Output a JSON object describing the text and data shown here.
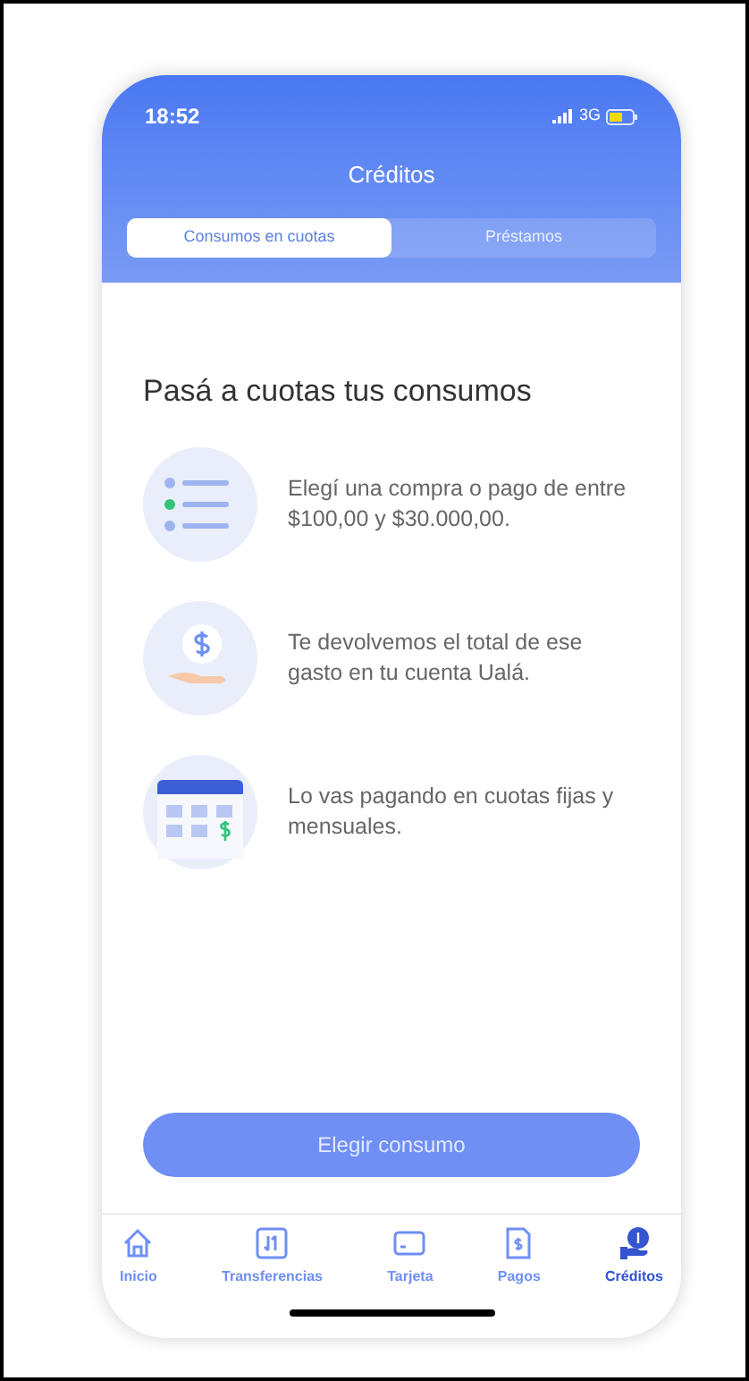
{
  "status_bar": {
    "time": "18:52",
    "network": "3G"
  },
  "header": {
    "title": "Créditos"
  },
  "tabs": [
    {
      "label": "Consumos en cuotas",
      "selected": true
    },
    {
      "label": "Préstamos",
      "selected": false
    }
  ],
  "heading": "Pasá a cuotas tus consumos",
  "steps": [
    {
      "kind": "list",
      "text": "Elegí una compra o pago de entre $100,00 y $30.000,00."
    },
    {
      "kind": "cash",
      "text": "Te devolvemos el total de ese gasto en tu cuenta Ualá."
    },
    {
      "kind": "calendar",
      "text": "Lo vas pagando en cuotas fijas y mensuales."
    }
  ],
  "primary_button": "Elegir consumo",
  "bottom_nav": [
    {
      "kind": "home",
      "label": "Inicio",
      "selected": false
    },
    {
      "kind": "transfer",
      "label": "Transferencias",
      "selected": false
    },
    {
      "kind": "card",
      "label": "Tarjeta",
      "selected": false
    },
    {
      "kind": "bill",
      "label": "Pagos",
      "selected": false
    },
    {
      "kind": "credit",
      "label": "Créditos",
      "selected": true
    }
  ]
}
